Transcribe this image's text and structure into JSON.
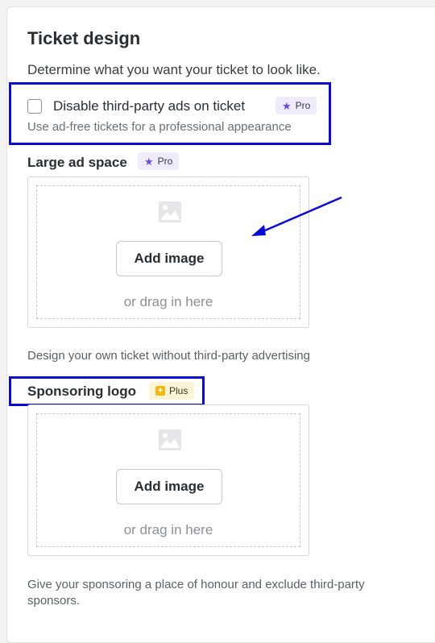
{
  "section": {
    "title": "Ticket design",
    "subtitle": "Determine what you want your ticket to look like."
  },
  "disable_ads": {
    "label": "Disable third-party ads on ticket",
    "help": "Use ad-free tickets for a professional appearance",
    "checked": false,
    "badge": "Pro"
  },
  "large_ad": {
    "label": "Large ad space",
    "badge": "Pro",
    "add_button": "Add image",
    "drag_text": "or drag in here",
    "help": "Design your own ticket without third-party advertising"
  },
  "sponsor_logo": {
    "label": "Sponsoring logo",
    "badge": "Plus",
    "add_button": "Add image",
    "drag_text": "or drag in here",
    "help": "Give your sponsoring a place of honour and exclude third-party sponsors."
  },
  "icons": {
    "pro_badge": "star-icon",
    "plus_badge": "plus-square-icon",
    "upload_placeholder": "image-icon"
  },
  "colors": {
    "annotation": "#0a0ad0",
    "pro_star": "#6a4cd8",
    "plus_square": "#f2b90f"
  }
}
